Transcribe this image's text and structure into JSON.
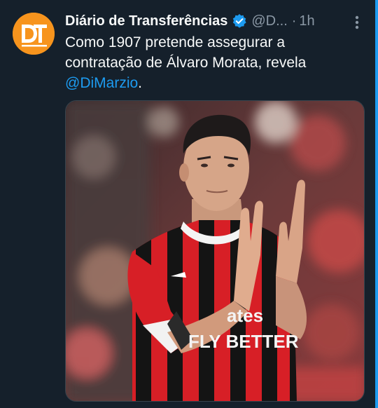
{
  "tweet": {
    "author": {
      "display_name": "Diário de Transferências",
      "handle": "@D...",
      "avatar_text": "DT",
      "verified": true
    },
    "separator": "·",
    "time": "1h",
    "text_before": "Como 1907 pretende assegurar a contratação de Álvaro Morata, revela ",
    "mention": "@DiMarzio",
    "text_after": ".",
    "media": {
      "jersey_text_line1": "ates",
      "jersey_text_line2": "FLY BETTER"
    }
  },
  "icons": {
    "verified": "verified-badge-icon",
    "more": "more-options-icon"
  },
  "colors": {
    "background": "#15202b",
    "accent": "#1d9bf0",
    "avatar": "#f7941d",
    "secondary_text": "#8b98a5"
  }
}
